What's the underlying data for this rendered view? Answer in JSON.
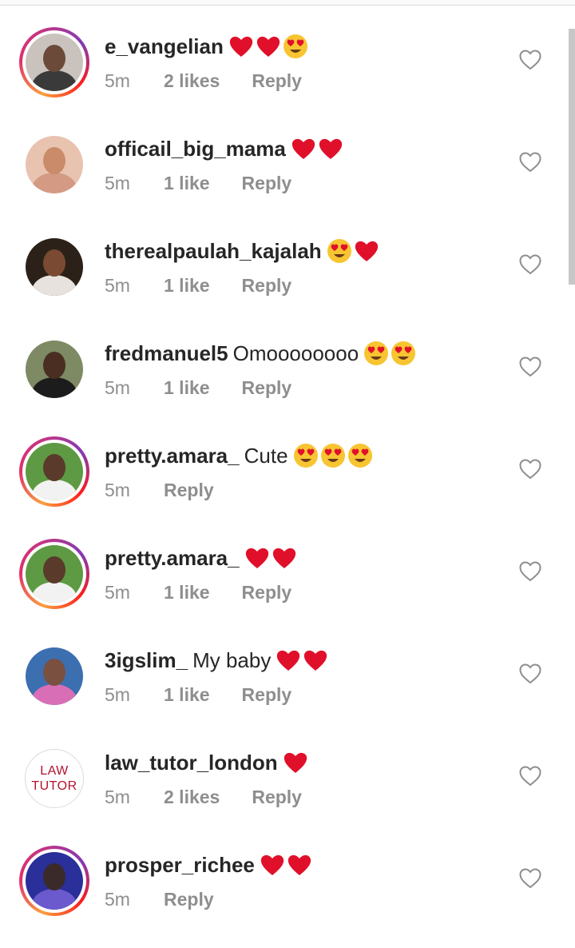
{
  "comments": [
    {
      "username": "e_vangelian",
      "text": "",
      "emojis": [
        "heart",
        "heart",
        "heart-eyes"
      ],
      "time": "5m",
      "likes": "2 likes",
      "reply": "Reply",
      "story_ring": true,
      "avatar_skin": "#6b4a3a",
      "avatar_bg": "#c9c2bd",
      "avatar_body": "#3a3a3a"
    },
    {
      "username": "officail_big_mama",
      "text": "",
      "emojis": [
        "heart",
        "heart"
      ],
      "time": "5m",
      "likes": "1 like",
      "reply": "Reply",
      "story_ring": false,
      "avatar_skin": "#c98b6a",
      "avatar_bg": "#e8c3b0",
      "avatar_body": "#d49a84"
    },
    {
      "username": "therealpaulah_kajalah",
      "text": "",
      "emojis": [
        "heart-eyes",
        "heart"
      ],
      "time": "5m",
      "likes": "1 like",
      "reply": "Reply",
      "story_ring": false,
      "avatar_skin": "#7a4a33",
      "avatar_bg": "#2b2118",
      "avatar_body": "#e8e2de"
    },
    {
      "username": "fredmanuel5",
      "text": "Omoooooooo",
      "emojis": [
        "heart-eyes",
        "heart-eyes"
      ],
      "time": "5m",
      "likes": "1 like",
      "reply": "Reply",
      "story_ring": false,
      "avatar_skin": "#4a2e22",
      "avatar_bg": "#7d8a63",
      "avatar_body": "#1c1c1c"
    },
    {
      "username": "pretty.amara_",
      "text": "Cute",
      "emojis": [
        "heart-eyes",
        "heart-eyes",
        "heart-eyes"
      ],
      "time": "5m",
      "likes": "",
      "reply": "Reply",
      "story_ring": true,
      "avatar_skin": "#5a3a2a",
      "avatar_bg": "#5d9a43",
      "avatar_body": "#f2f2f2"
    },
    {
      "username": "pretty.amara_",
      "text": "",
      "emojis": [
        "heart",
        "heart"
      ],
      "time": "5m",
      "likes": "1 like",
      "reply": "Reply",
      "story_ring": true,
      "avatar_skin": "#5a3a2a",
      "avatar_bg": "#5d9a43",
      "avatar_body": "#f2f2f2"
    },
    {
      "username": "3igslim_",
      "text": "My baby",
      "emojis": [
        "heart",
        "heart"
      ],
      "time": "5m",
      "likes": "1 like",
      "reply": "Reply",
      "story_ring": false,
      "avatar_skin": "#7a5040",
      "avatar_bg": "#3c6fb0",
      "avatar_body": "#d86fb6"
    },
    {
      "username": "law_tutor_london",
      "text": "",
      "emojis": [
        "heart"
      ],
      "time": "5m",
      "likes": "2 likes",
      "reply": "Reply",
      "story_ring": false,
      "logo_line1": "LAW",
      "logo_line2": "TUTOR"
    },
    {
      "username": "prosper_richee",
      "text": "",
      "emojis": [
        "heart",
        "heart"
      ],
      "time": "5m",
      "likes": "",
      "reply": "Reply",
      "story_ring": true,
      "avatar_skin": "#3a2a2a",
      "avatar_bg": "#2a2f9a",
      "avatar_body": "#6a5acd"
    }
  ],
  "colors": {
    "heart": "#e0102a",
    "heart_eyes_face": "#f7c531",
    "meta_text": "#8e8e8e",
    "like_icon": "#8e8e8e"
  },
  "icons": {
    "like": "heart-outline-icon",
    "emoji_heart": "red-heart-emoji",
    "emoji_heart_eyes": "heart-eyes-emoji"
  }
}
